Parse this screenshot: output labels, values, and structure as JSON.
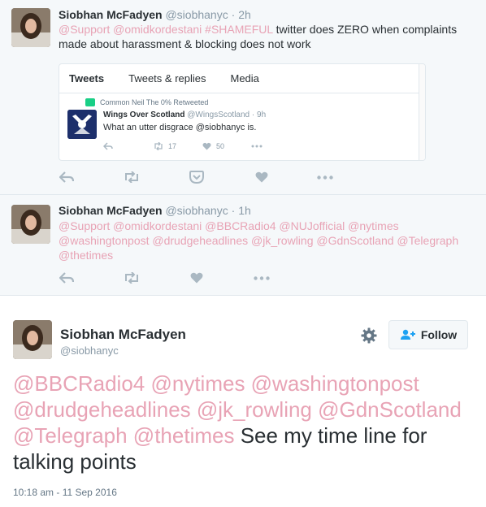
{
  "tweet1": {
    "name": "Siobhan McFadyen",
    "handle": "@siobhanyc",
    "dot": "·",
    "time": "2h",
    "mentions_a": "@Support @omidkordestani #SHAMEFUL",
    "text_a": " twitter does ZERO when complaints made about harassment & blocking does not work",
    "card": {
      "tabs": [
        "Tweets",
        "Tweets & replies",
        "Media"
      ],
      "retweet_line": "Common Neil The 0% Retweeted",
      "inner_name": "Wings Over Scotland",
      "inner_handle": "@WingsScotland",
      "inner_dot": "·",
      "inner_time": "9h",
      "inner_text": "What an utter disgrace @siobhanyc is.",
      "retweets": "17",
      "likes": "50"
    }
  },
  "tweet2": {
    "name": "Siobhan McFadyen",
    "handle": "@siobhanyc",
    "dot": "·",
    "time": "1h",
    "mentions": "@Support @omidkordestani @BBCRadio4 @NUJofficial @nytimes @washingtonpost @drudgeheadlines @jk_rowling @GdnScotland @Telegraph @thetimes"
  },
  "main": {
    "name": "Siobhan McFadyen",
    "handle": "@siobhanyc",
    "follow_label": "Follow",
    "mentions": "@BBCRadio4 @nytimes @washingtonpost @drudgeheadlines @jk_rowling @GdnScotland @Telegraph @thetimes",
    "text": " See my time line for talking points",
    "timestamp": "10:18 am - 11 Sep 2016"
  },
  "colors": {
    "mention": "#e8a3b5",
    "grey_bg": "#f5f8fa",
    "icon_grey": "#aab8c2",
    "retweet_green": "#19cf86"
  },
  "icons": [
    "reply-icon",
    "retweet-icon",
    "pocket-icon",
    "like-icon",
    "more-icon",
    "gear-icon",
    "follow-user-icon"
  ]
}
